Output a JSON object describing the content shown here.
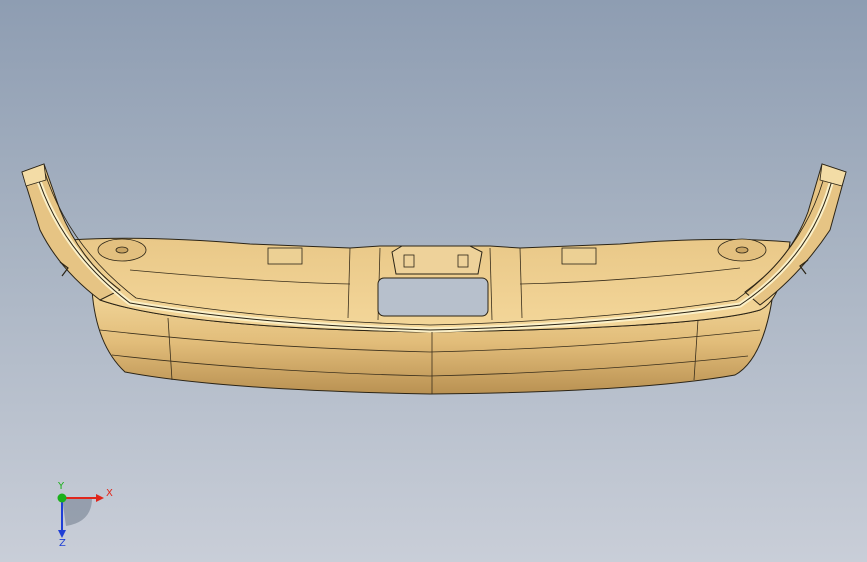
{
  "viewport": {
    "background_top": "#8e9db2",
    "background_bottom": "#c9ced8"
  },
  "model": {
    "fill_color": "#e8c886",
    "shade_color": "#cfa867",
    "edge_color": "#2b2416"
  },
  "triad": {
    "x_label": "X",
    "y_label": "Y",
    "z_label": "Z",
    "x_color": "#e0261b",
    "y_color": "#1bb01b",
    "z_color": "#1f3fd6"
  }
}
